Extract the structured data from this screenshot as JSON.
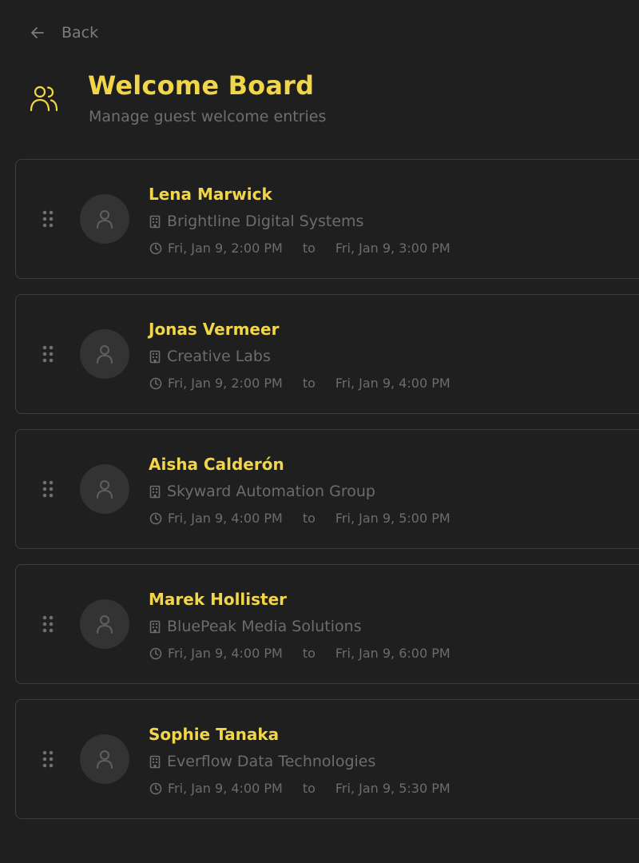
{
  "header": {
    "back_label": "Back",
    "title": "Welcome Board",
    "subtitle": "Manage guest welcome entries"
  },
  "colors": {
    "background": "#1f1f1f",
    "accent": "#f2d649",
    "muted_text": "#6c6c6c",
    "card_border": "#3c3c3c",
    "avatar_bg": "#333333"
  },
  "icons": {
    "back": "arrow-left-icon",
    "header": "users-icon",
    "drag": "drag-handle-icon",
    "avatar": "user-icon",
    "company": "building-icon",
    "time": "clock-icon"
  },
  "entries": [
    {
      "name": "Lena Marwick",
      "company": "Brightline Digital Systems",
      "start": "Fri, Jan 9, 2:00 PM",
      "to": "to",
      "end": "Fri, Jan 9, 3:00 PM"
    },
    {
      "name": "Jonas Vermeer",
      "company": "Creative Labs",
      "start": "Fri, Jan 9, 2:00 PM",
      "to": "to",
      "end": "Fri, Jan 9, 4:00 PM"
    },
    {
      "name": "Aisha Calderón",
      "company": "Skyward Automation Group",
      "start": "Fri, Jan 9, 4:00 PM",
      "to": "to",
      "end": "Fri, Jan 9, 5:00 PM"
    },
    {
      "name": "Marek Hollister",
      "company": "BluePeak Media Solutions",
      "start": "Fri, Jan 9, 4:00 PM",
      "to": "to",
      "end": "Fri, Jan 9, 6:00 PM"
    },
    {
      "name": "Sophie Tanaka",
      "company": "Everflow Data Technologies",
      "start": "Fri, Jan 9, 4:00 PM",
      "to": "to",
      "end": "Fri, Jan 9, 5:30 PM"
    }
  ]
}
